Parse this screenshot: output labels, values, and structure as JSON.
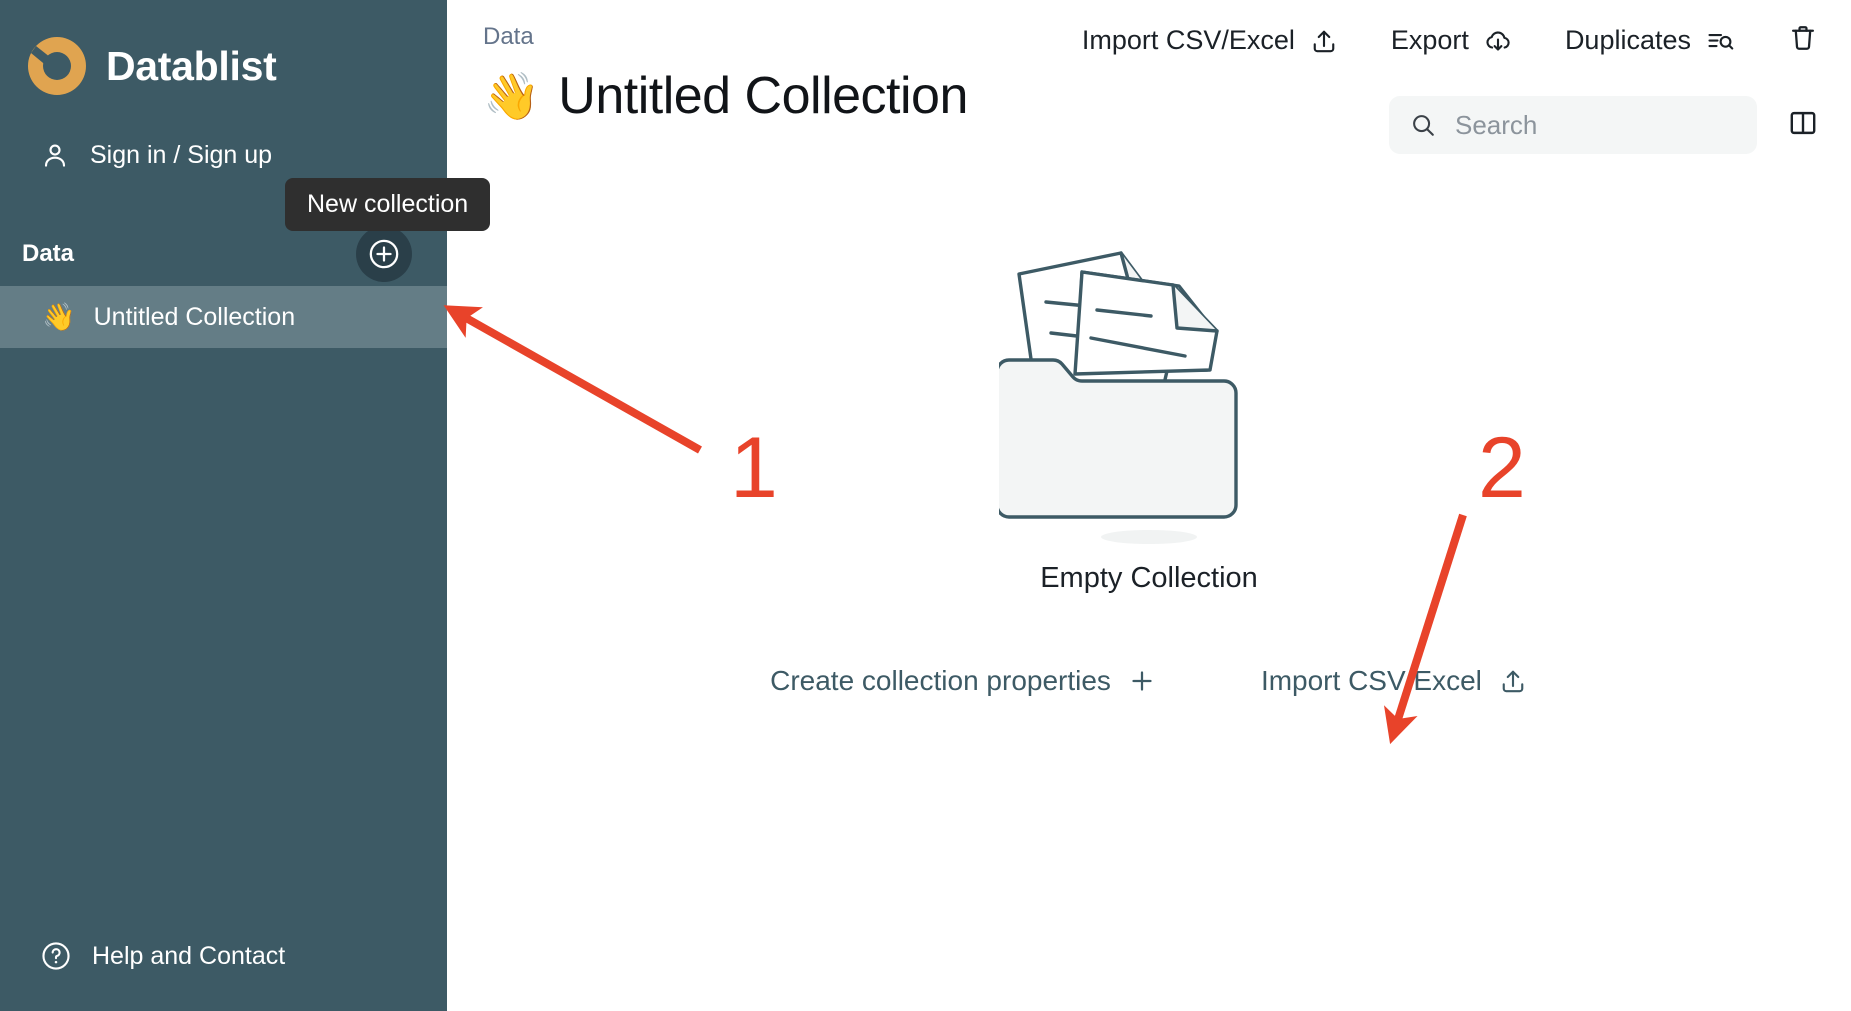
{
  "brand": {
    "name": "Datablist",
    "logo_icon": "datablist-logo-icon",
    "accent_color": "#e0a450"
  },
  "sidebar": {
    "background_color": "#3d5a65",
    "selected_color": "#647d86",
    "signin": {
      "label": "Sign in / Sign up",
      "icon": "user-icon"
    },
    "section": {
      "title": "Data",
      "new_collection_icon": "plus-circle-icon"
    },
    "collections": [
      {
        "emoji": "👋",
        "label": "Untitled Collection",
        "selected": true
      }
    ],
    "footer": {
      "label": "Help and Contact",
      "icon": "question-circle-icon"
    }
  },
  "tooltip": {
    "text": "New collection",
    "background_color": "#2f2f2f"
  },
  "header": {
    "breadcrumb": "Data",
    "title_emoji": "👋",
    "title": "Untitled Collection",
    "actions": [
      {
        "label": "Import CSV/Excel",
        "icon": "upload-icon"
      },
      {
        "label": "Export",
        "icon": "cloud-download-icon"
      },
      {
        "label": "Duplicates",
        "icon": "list-search-icon"
      }
    ],
    "delete_icon": "trash-icon",
    "panel_icon": "split-panel-icon"
  },
  "search": {
    "placeholder": "Search",
    "value": "",
    "icon": "search-icon"
  },
  "empty_state": {
    "illustration_icon": "folder-documents-icon",
    "title": "Empty Collection",
    "actions": [
      {
        "label": "Create collection properties",
        "icon": "plus-icon"
      },
      {
        "label": "Import CSV/Excel",
        "icon": "upload-icon"
      }
    ]
  },
  "annotations": {
    "color": "#e8432a",
    "markers": [
      {
        "number": "1",
        "points_to": "new-collection-button"
      },
      {
        "number": "2",
        "points_to": "empty-state-import-link"
      }
    ]
  }
}
